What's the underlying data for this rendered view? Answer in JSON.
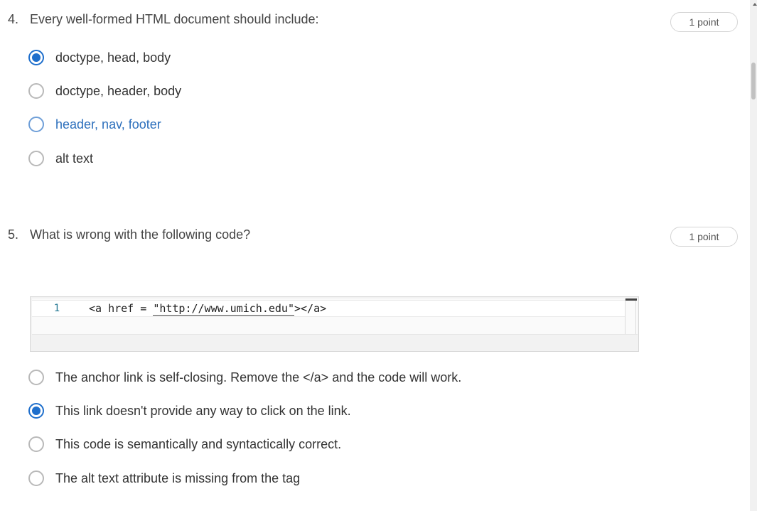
{
  "questions": [
    {
      "number": "4.",
      "text": "Every well-formed HTML document should include:",
      "points": "1 point",
      "options": [
        {
          "label": "doctype, head, body",
          "state": "checked"
        },
        {
          "label": "doctype, header, body",
          "state": "unchecked"
        },
        {
          "label": "header, nav, footer",
          "state": "hover"
        },
        {
          "label": "alt text",
          "state": "unchecked"
        }
      ]
    },
    {
      "number": "5.",
      "text": "What is wrong with the following code?",
      "points": "1 point",
      "code": {
        "line_number": "1",
        "prefix": "<a href = ",
        "string": "\"http://www.umich.edu\"",
        "suffix": "></a>"
      },
      "options": [
        {
          "label": "The anchor link is self-closing.  Remove the </a> and the code will work.",
          "state": "unchecked"
        },
        {
          "label": "This link doesn't provide any way to click on the link.",
          "state": "checked"
        },
        {
          "label": "This code is semantically and syntactically correct.",
          "state": "unchecked"
        },
        {
          "label": "The alt text attribute is missing from the tag",
          "state": "unchecked"
        }
      ]
    }
  ],
  "colors": {
    "accent": "#1f6fcc",
    "link": "#2c6fbc",
    "text": "#333333"
  }
}
